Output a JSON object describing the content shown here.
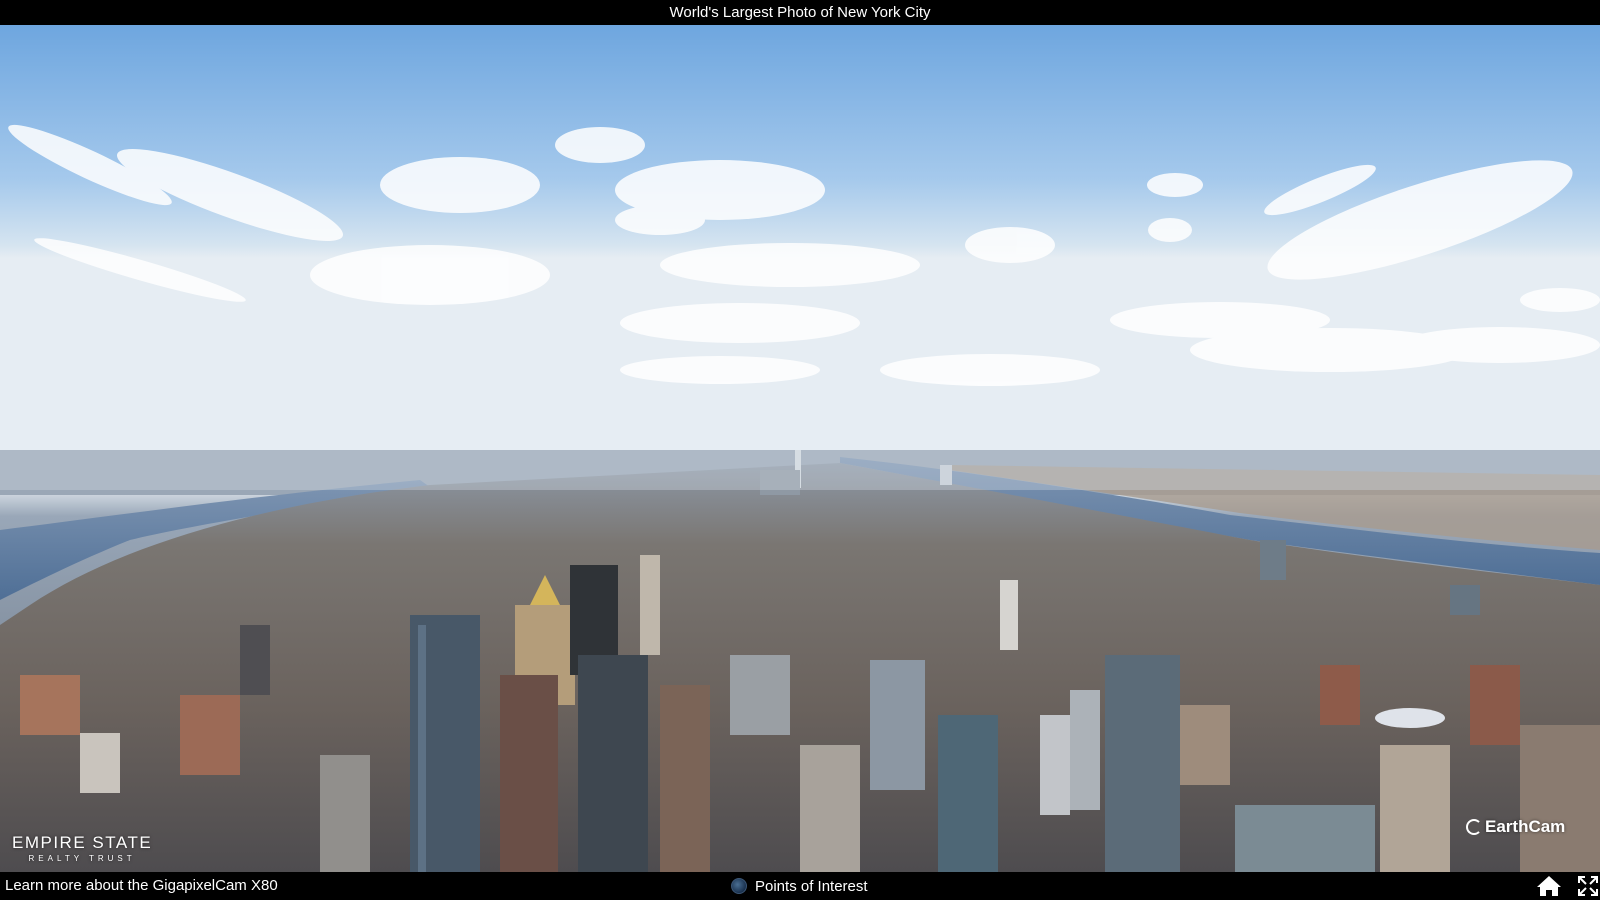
{
  "header": {
    "title": "World's Largest Photo of New York City"
  },
  "panorama": {
    "description_icon": "city-panorama-image"
  },
  "watermarks": {
    "left_logo_line1": "EMPIRE STATE",
    "left_logo_line2": "REALTY TRUST",
    "right_logo": "EarthCam"
  },
  "footer": {
    "learn_more_link": "Learn more about the GigapixelCam X80",
    "points_of_interest_label": "Points of Interest",
    "home_icon": "home-icon",
    "fullscreen_icon": "fullscreen-icon"
  }
}
